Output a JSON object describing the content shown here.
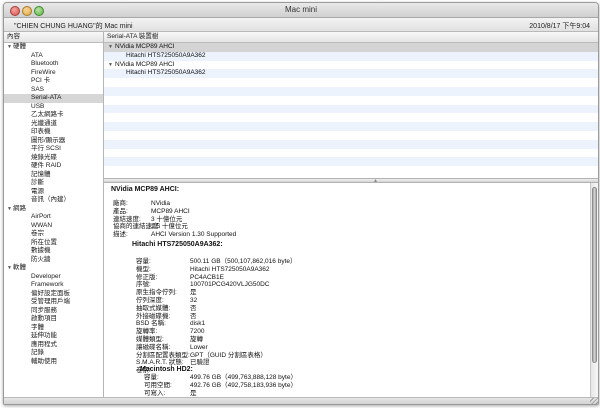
{
  "window": {
    "title": "Mac mini"
  },
  "infobar": {
    "machine_name": "\"CHIEN CHUNG HUANG\"的 Mac mini",
    "datetime": "2010/8/17 下午9:04"
  },
  "sidebar": {
    "header": "內容",
    "groups": [
      {
        "label": "硬體",
        "items": [
          "ATA",
          "Bluetooth",
          "FireWire",
          "PCI 卡",
          "SAS",
          "Serial-ATA",
          "USB",
          "乙太網路卡",
          "光纖通道",
          "印表機",
          "圖形/顯示器",
          "平行 SCSI",
          "燒錄光碟",
          "硬件 RAID",
          "記憶體",
          "診斷",
          "電源",
          "音訊（內建）"
        ]
      },
      {
        "label": "網路",
        "items": [
          "AirPort",
          "WWAN",
          "卷宗",
          "所在位置",
          "數據機",
          "防火牆"
        ]
      },
      {
        "label": "軟體",
        "items": [
          "Developer",
          "Framework",
          "偏好設定面板",
          "受管理用戶端",
          "同步服務",
          "啟動項目",
          "字體",
          "延伸功能",
          "應用程式",
          "記錄",
          "輔助使用"
        ]
      }
    ],
    "selected": "Serial-ATA"
  },
  "list": {
    "header": "Serial-ATA 裝置樹",
    "rows": [
      {
        "label": "NVidia MCP89 AHCI",
        "level": 0,
        "selected": true
      },
      {
        "label": "Hitachi HTS725050A9A362",
        "level": 1
      },
      {
        "label": "NVidia MCP89 AHCI",
        "level": 0
      },
      {
        "label": "Hitachi HTS725050A9A362",
        "level": 1
      }
    ]
  },
  "detail": {
    "title": "NVidia MCP89 AHCI:",
    "controller": [
      {
        "k": "廠商:",
        "v": "NVidia"
      },
      {
        "k": "產品:",
        "v": "MCP89 AHCI"
      },
      {
        "k": "連結速度:",
        "v": "3 十億位元"
      },
      {
        "k": "協商的連結速度:",
        "v": "1.5 十億位元"
      },
      {
        "k": "描述:",
        "v": "AHCI Version 1.30 Supported"
      }
    ],
    "drive_title": "Hitachi HTS725050A9A362:",
    "drive": [
      {
        "k": "容量:",
        "v": "500.11 GB（500,107,862,016 byte）"
      },
      {
        "k": "機型:",
        "v": "Hitachi HTS725050A9A362"
      },
      {
        "k": "修正版:",
        "v": "PC4ACB1E"
      },
      {
        "k": "序號:",
        "v": "100701PCG420VLJG50DC"
      },
      {
        "k": "原生指令佇列:",
        "v": "是"
      },
      {
        "k": "佇列深度:",
        "v": "32"
      },
      {
        "k": "抽取式媒體:",
        "v": "否"
      },
      {
        "k": "外接磁碟機:",
        "v": "否"
      },
      {
        "k": "BSD 名稱:",
        "v": "disk1"
      },
      {
        "k": "旋轉率:",
        "v": "7200"
      },
      {
        "k": "媒體類型:",
        "v": "旋轉"
      },
      {
        "k": "讓磁碟名稱:",
        "v": "Lower"
      },
      {
        "k": "分割區配置表類型:",
        "v": "GPT（GUID 分割區表格）"
      },
      {
        "k": "S.M.A.R.T. 狀態:",
        "v": "已驗證"
      },
      {
        "k": "卷宗:",
        "v": ""
      }
    ],
    "volume_title": "Macintosh HD2:",
    "volume": [
      {
        "k": "容量:",
        "v": "499.76 GB（499,763,888,128 byte）"
      },
      {
        "k": "可用空間:",
        "v": "492.76 GB（492,758,183,936 byte）"
      },
      {
        "k": "可寫入:",
        "v": "是"
      }
    ]
  },
  "icons": {
    "expand": "disclosure-triangle-icon",
    "collapse": "disclosure-triangle-icon"
  },
  "colors": {
    "stripe": "#edf3fd",
    "selection": "#d6d6d6"
  }
}
